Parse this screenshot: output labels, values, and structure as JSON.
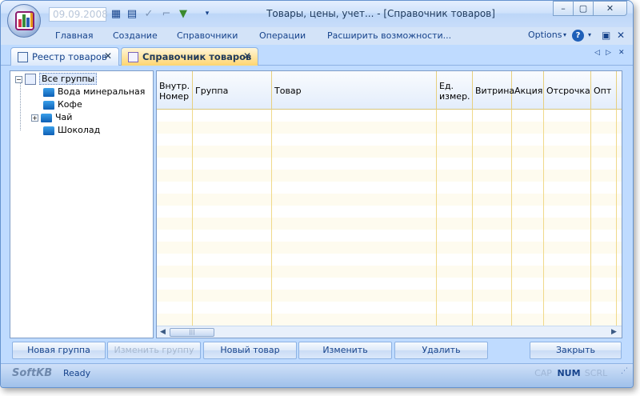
{
  "titlebar": {
    "date": "09.09.2008",
    "title": "Товары, цены, учет... - [Справочник товаров]",
    "minimize": "–",
    "maximize": "▢",
    "close": "✕"
  },
  "menu": {
    "items": [
      "Главная",
      "Создание",
      "Справочники",
      "Операции",
      "Расширить возможности..."
    ],
    "options": "Options"
  },
  "tabs": [
    {
      "label": "Реестр товаров",
      "close": "✕"
    },
    {
      "label": "Справочник товаров",
      "close": "✕"
    }
  ],
  "tree": {
    "root": "Все группы",
    "items": [
      "Вода минеральная",
      "Кофе",
      "Чай",
      "Шоколад"
    ]
  },
  "grid": {
    "columns": [
      {
        "label": "Внутр. Номер"
      },
      {
        "label": "Группа"
      },
      {
        "label": "Товар"
      },
      {
        "label": "Ед. измер."
      },
      {
        "label": "Витрина"
      },
      {
        "label": "Акция"
      },
      {
        "label": "Отсрочка"
      },
      {
        "label": "Опт"
      }
    ]
  },
  "buttons": {
    "new_group": "Новая группа",
    "edit_group": "Изменить группу",
    "new_item": "Новый товар",
    "edit": "Изменить",
    "delete": "Удалить",
    "close": "Закрыть"
  },
  "status": {
    "logo": "SoftKB",
    "text": "Ready",
    "caps": "CAP",
    "num": "NUM",
    "scrl": "SCRL"
  },
  "colors": {
    "frame": "#bfdbff",
    "active_tab": "#ffd56f",
    "grid_stripe": "#fefbef"
  }
}
